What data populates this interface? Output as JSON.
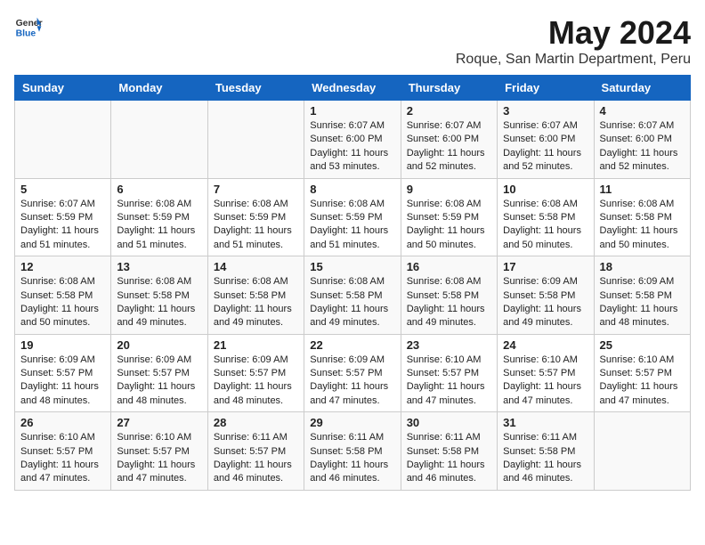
{
  "header": {
    "logo_general": "General",
    "logo_blue": "Blue",
    "month_year": "May 2024",
    "location": "Roque, San Martin Department, Peru"
  },
  "days_of_week": [
    "Sunday",
    "Monday",
    "Tuesday",
    "Wednesday",
    "Thursday",
    "Friday",
    "Saturday"
  ],
  "weeks": [
    [
      {
        "day": "",
        "info": ""
      },
      {
        "day": "",
        "info": ""
      },
      {
        "day": "",
        "info": ""
      },
      {
        "day": "1",
        "info": "Sunrise: 6:07 AM\nSunset: 6:00 PM\nDaylight: 11 hours and 53 minutes."
      },
      {
        "day": "2",
        "info": "Sunrise: 6:07 AM\nSunset: 6:00 PM\nDaylight: 11 hours and 52 minutes."
      },
      {
        "day": "3",
        "info": "Sunrise: 6:07 AM\nSunset: 6:00 PM\nDaylight: 11 hours and 52 minutes."
      },
      {
        "day": "4",
        "info": "Sunrise: 6:07 AM\nSunset: 6:00 PM\nDaylight: 11 hours and 52 minutes."
      }
    ],
    [
      {
        "day": "5",
        "info": "Sunrise: 6:07 AM\nSunset: 5:59 PM\nDaylight: 11 hours and 51 minutes."
      },
      {
        "day": "6",
        "info": "Sunrise: 6:08 AM\nSunset: 5:59 PM\nDaylight: 11 hours and 51 minutes."
      },
      {
        "day": "7",
        "info": "Sunrise: 6:08 AM\nSunset: 5:59 PM\nDaylight: 11 hours and 51 minutes."
      },
      {
        "day": "8",
        "info": "Sunrise: 6:08 AM\nSunset: 5:59 PM\nDaylight: 11 hours and 51 minutes."
      },
      {
        "day": "9",
        "info": "Sunrise: 6:08 AM\nSunset: 5:59 PM\nDaylight: 11 hours and 50 minutes."
      },
      {
        "day": "10",
        "info": "Sunrise: 6:08 AM\nSunset: 5:58 PM\nDaylight: 11 hours and 50 minutes."
      },
      {
        "day": "11",
        "info": "Sunrise: 6:08 AM\nSunset: 5:58 PM\nDaylight: 11 hours and 50 minutes."
      }
    ],
    [
      {
        "day": "12",
        "info": "Sunrise: 6:08 AM\nSunset: 5:58 PM\nDaylight: 11 hours and 50 minutes."
      },
      {
        "day": "13",
        "info": "Sunrise: 6:08 AM\nSunset: 5:58 PM\nDaylight: 11 hours and 49 minutes."
      },
      {
        "day": "14",
        "info": "Sunrise: 6:08 AM\nSunset: 5:58 PM\nDaylight: 11 hours and 49 minutes."
      },
      {
        "day": "15",
        "info": "Sunrise: 6:08 AM\nSunset: 5:58 PM\nDaylight: 11 hours and 49 minutes."
      },
      {
        "day": "16",
        "info": "Sunrise: 6:08 AM\nSunset: 5:58 PM\nDaylight: 11 hours and 49 minutes."
      },
      {
        "day": "17",
        "info": "Sunrise: 6:09 AM\nSunset: 5:58 PM\nDaylight: 11 hours and 49 minutes."
      },
      {
        "day": "18",
        "info": "Sunrise: 6:09 AM\nSunset: 5:58 PM\nDaylight: 11 hours and 48 minutes."
      }
    ],
    [
      {
        "day": "19",
        "info": "Sunrise: 6:09 AM\nSunset: 5:57 PM\nDaylight: 11 hours and 48 minutes."
      },
      {
        "day": "20",
        "info": "Sunrise: 6:09 AM\nSunset: 5:57 PM\nDaylight: 11 hours and 48 minutes."
      },
      {
        "day": "21",
        "info": "Sunrise: 6:09 AM\nSunset: 5:57 PM\nDaylight: 11 hours and 48 minutes."
      },
      {
        "day": "22",
        "info": "Sunrise: 6:09 AM\nSunset: 5:57 PM\nDaylight: 11 hours and 47 minutes."
      },
      {
        "day": "23",
        "info": "Sunrise: 6:10 AM\nSunset: 5:57 PM\nDaylight: 11 hours and 47 minutes."
      },
      {
        "day": "24",
        "info": "Sunrise: 6:10 AM\nSunset: 5:57 PM\nDaylight: 11 hours and 47 minutes."
      },
      {
        "day": "25",
        "info": "Sunrise: 6:10 AM\nSunset: 5:57 PM\nDaylight: 11 hours and 47 minutes."
      }
    ],
    [
      {
        "day": "26",
        "info": "Sunrise: 6:10 AM\nSunset: 5:57 PM\nDaylight: 11 hours and 47 minutes."
      },
      {
        "day": "27",
        "info": "Sunrise: 6:10 AM\nSunset: 5:57 PM\nDaylight: 11 hours and 47 minutes."
      },
      {
        "day": "28",
        "info": "Sunrise: 6:11 AM\nSunset: 5:57 PM\nDaylight: 11 hours and 46 minutes."
      },
      {
        "day": "29",
        "info": "Sunrise: 6:11 AM\nSunset: 5:58 PM\nDaylight: 11 hours and 46 minutes."
      },
      {
        "day": "30",
        "info": "Sunrise: 6:11 AM\nSunset: 5:58 PM\nDaylight: 11 hours and 46 minutes."
      },
      {
        "day": "31",
        "info": "Sunrise: 6:11 AM\nSunset: 5:58 PM\nDaylight: 11 hours and 46 minutes."
      },
      {
        "day": "",
        "info": ""
      }
    ]
  ]
}
